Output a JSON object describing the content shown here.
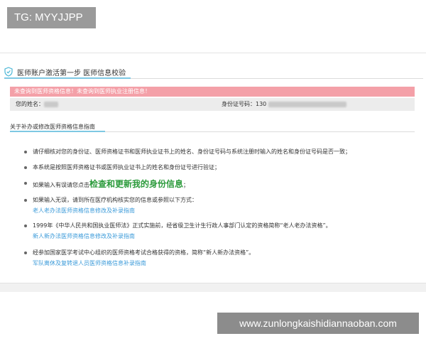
{
  "tag": "TG: MYYJJPP",
  "page": {
    "heading": "医师账户激活第一步 医师信息校验"
  },
  "alert": {
    "text": "未查询到医师资格信息！未查询到医师执业注册信息！"
  },
  "info": {
    "name_label": "您的姓名：",
    "id_label": "身份证号码：",
    "id_prefix": "130"
  },
  "guide": {
    "title": "关于补办或修改医师资格信息指南",
    "items": [
      {
        "text": "请仔细核对您的身份证、医师资格证书和医师执业证书上的姓名、身份证号码与系统注册时输入的姓名和身份证号码是否一致；"
      },
      {
        "text": "本系统是按照医师资格证书或医师执业证书上的姓名和身份证号进行验证；"
      },
      {
        "text_before": "如果输入有误请您点击",
        "link": "检查和更新我的身份信息",
        "text_after": "；"
      },
      {
        "text": "如果输入无误，请到所在医疗机构核实您的信息或参照以下方式：",
        "sub_link": "老人老办法医师资格信息修改及补录指南"
      },
      {
        "text": "1999年《中华人民共和国执业医师法》正式实施前，经省级卫生计生行政人事部门认定的资格简称“老人老办法资格”。",
        "sub_link": "新人新办法医师资格信息修改及补录指南"
      },
      {
        "text": "经参加国家医学考试中心组织的医师资格考试合格获得的资格，简称“新人新办法资格”。",
        "sub_link": "军队离休及复转退人员医师资格信息补录指南"
      }
    ]
  },
  "watermark": "www.zunlongkaishidiannaoban.com",
  "colors": {
    "alert_bg": "#f4a0a8",
    "link_green": "#2a9a3a",
    "link_blue": "#3a9ad9",
    "accent_underline": "#7ec8e3"
  }
}
